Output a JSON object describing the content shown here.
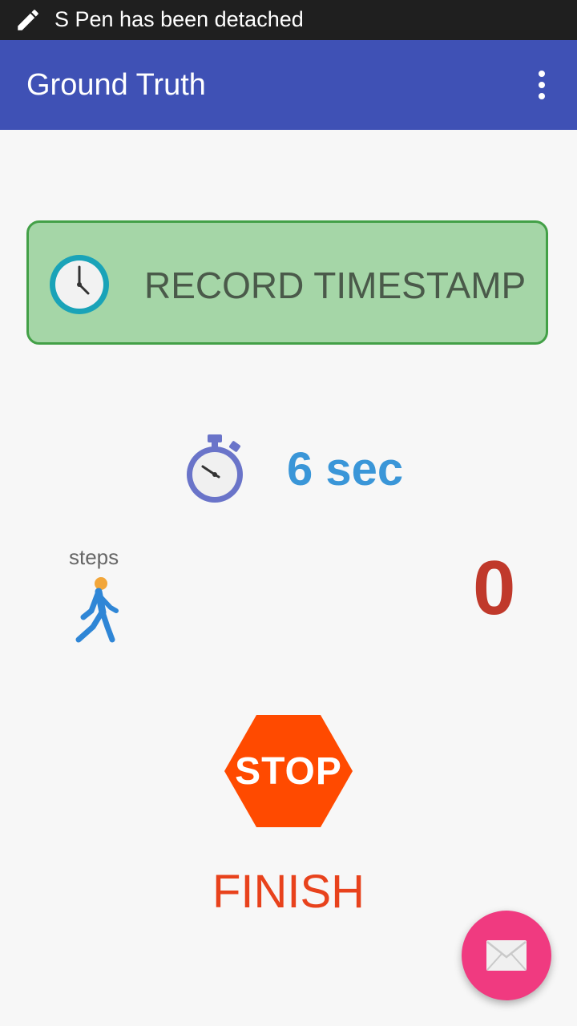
{
  "status_bar": {
    "icon": "pen-icon",
    "text": "S Pen has been detached"
  },
  "app_bar": {
    "title": "Ground Truth",
    "overflow_icon": "more-vert-icon"
  },
  "record_button": {
    "icon": "clock-icon",
    "label": "RECORD TIMESTAMP"
  },
  "timer": {
    "icon": "stopwatch-icon",
    "value": "6 sec"
  },
  "steps": {
    "label": "steps",
    "icon": "walker-icon",
    "count": "0"
  },
  "stop_button": {
    "sign_text": "STOP",
    "label": "FINISH"
  },
  "fab": {
    "icon": "mail-icon"
  },
  "colors": {
    "app_bar": "#3f51b5",
    "record_bg": "#a5d6a7",
    "record_border": "#43a047",
    "timer_text": "#3a96d8",
    "steps_count": "#c0392b",
    "stop_sign": "#ff4a00",
    "finish_text": "#e8421c",
    "fab": "#f03a80"
  }
}
